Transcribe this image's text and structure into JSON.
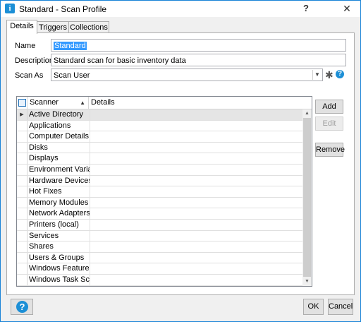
{
  "window": {
    "title": "Standard - Scan Profile",
    "help_label": "?",
    "close_label": "✕"
  },
  "tabs": [
    {
      "label": "Details"
    },
    {
      "label": "Triggers"
    },
    {
      "label": "Collections"
    }
  ],
  "form": {
    "name_label": "Name",
    "name_value": "Standard",
    "description_label": "Description",
    "description_value": "Standard scan for basic inventory data",
    "scan_as_label": "Scan As",
    "scan_as_value": "Scan User"
  },
  "grid": {
    "columns": [
      {
        "label": "Scanner"
      },
      {
        "label": "Details"
      }
    ],
    "rows": [
      {
        "scanner": "Active Directory"
      },
      {
        "scanner": "Applications"
      },
      {
        "scanner": "Computer Details"
      },
      {
        "scanner": "Disks"
      },
      {
        "scanner": "Displays"
      },
      {
        "scanner": "Environment Variable"
      },
      {
        "scanner": "Hardware Devices"
      },
      {
        "scanner": "Hot Fixes"
      },
      {
        "scanner": "Memory Modules"
      },
      {
        "scanner": "Network Adapters"
      },
      {
        "scanner": "Printers (local)"
      },
      {
        "scanner": "Services"
      },
      {
        "scanner": "Shares"
      },
      {
        "scanner": "Users & Groups"
      },
      {
        "scanner": "Windows Features"
      },
      {
        "scanner": "Windows Task Sched"
      }
    ]
  },
  "side_buttons": {
    "add": "Add",
    "edit": "Edit",
    "remove": "Remove"
  },
  "footer": {
    "ok": "OK",
    "cancel": "Cancel",
    "help_icon": "?"
  },
  "colors": {
    "accent": "#1c8fd6",
    "selection": "#3399ff"
  }
}
